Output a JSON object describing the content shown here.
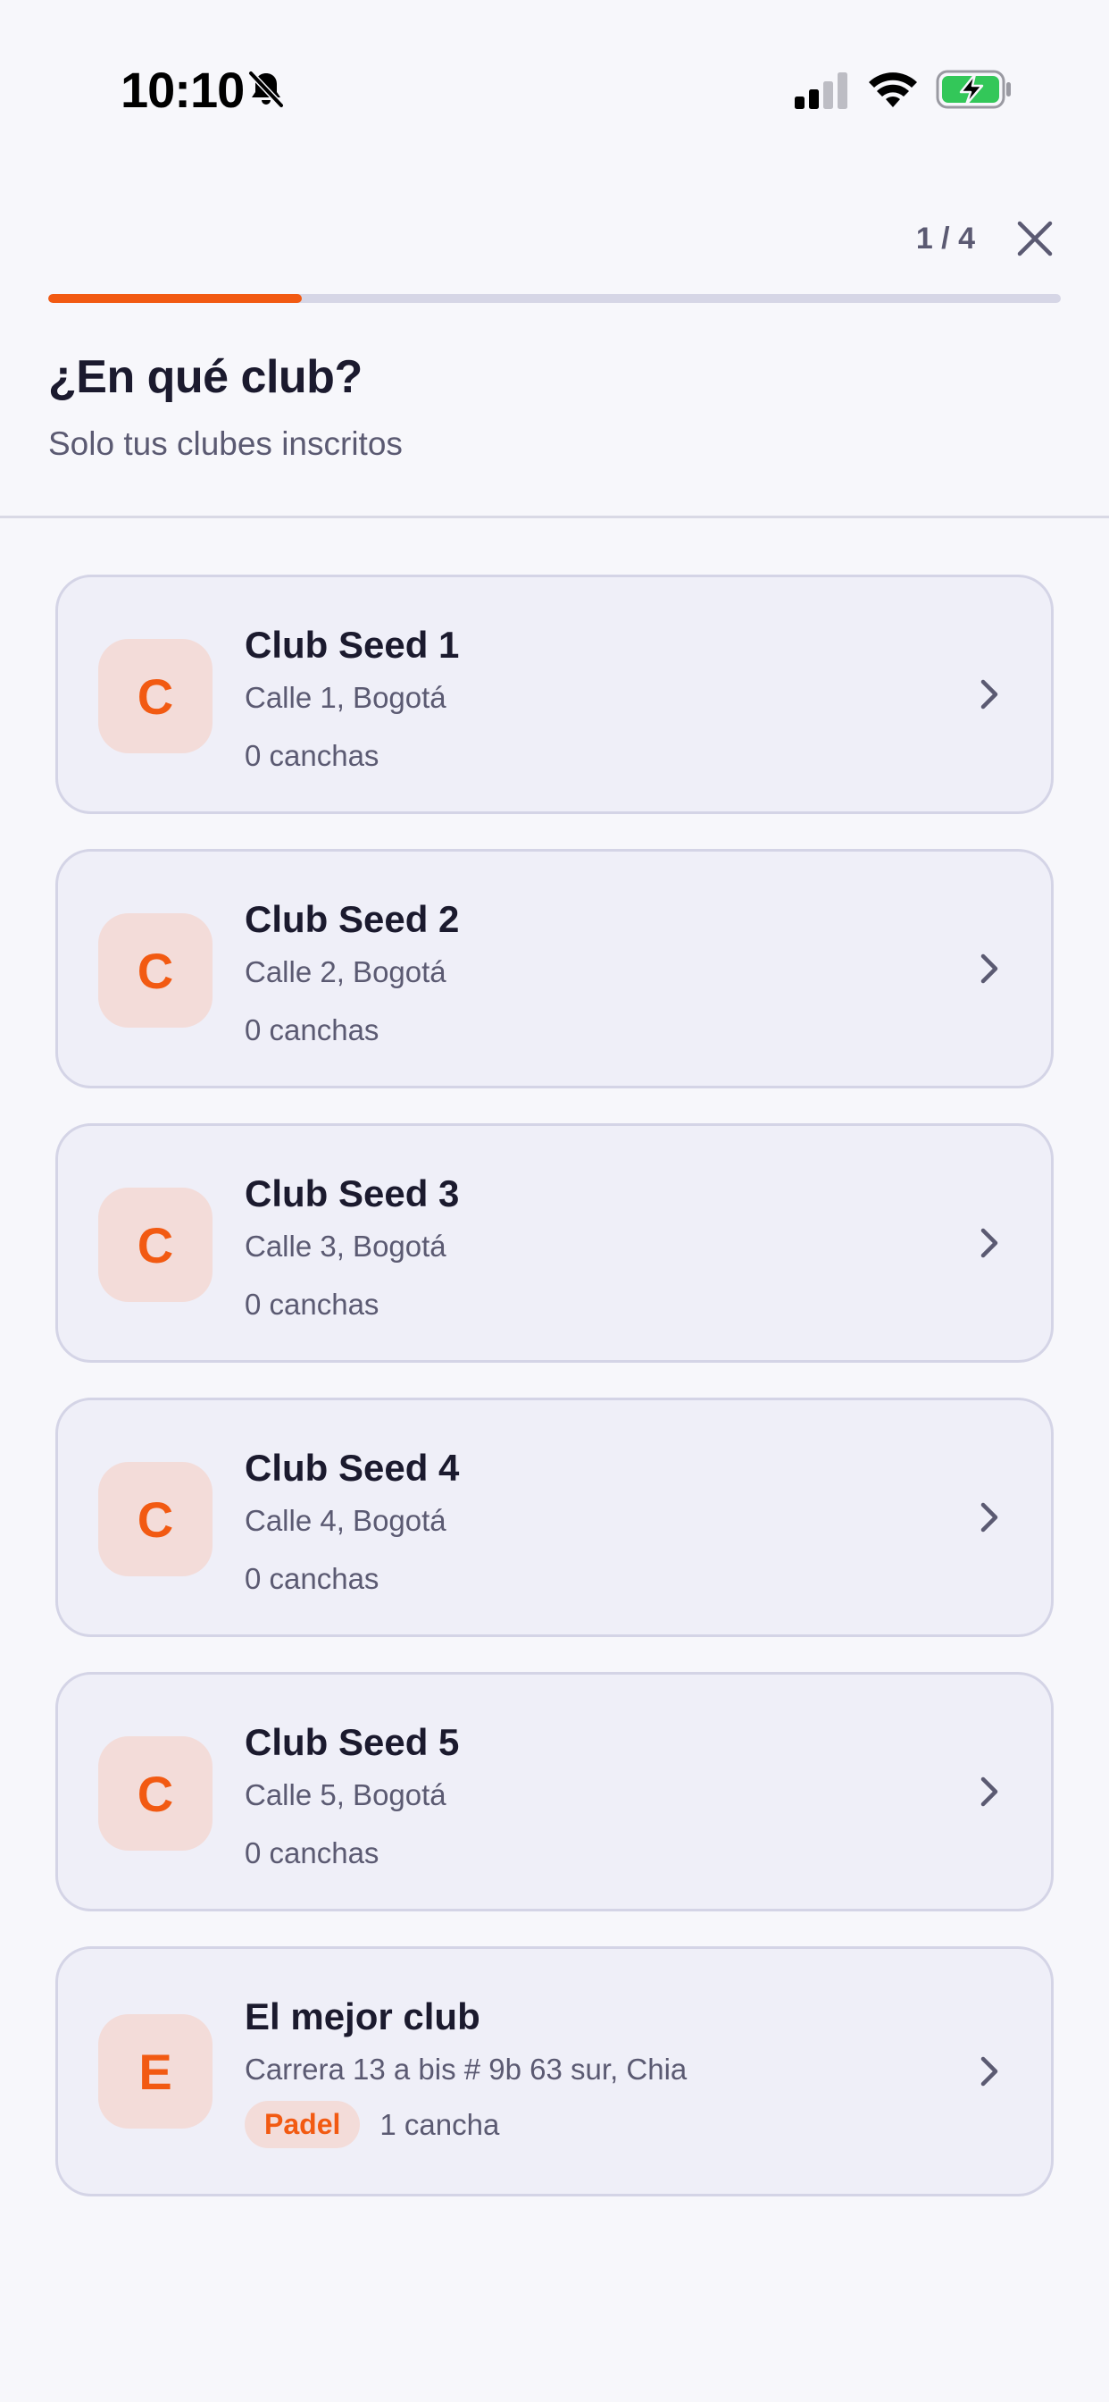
{
  "status_bar": {
    "time": "10:10",
    "icons": [
      "bell-muted-icon",
      "signal-icon",
      "wifi-icon",
      "battery-charging-icon"
    ]
  },
  "header": {
    "step_counter": "1 / 4",
    "close_icon": "close-icon",
    "progress": 0.25,
    "title": "¿En qué club?",
    "subtitle": "Solo tus clubes inscritos"
  },
  "colors": {
    "accent": "#f25a12",
    "avatar_bg": "#f3dcd9",
    "card_bg": "#efeff8",
    "card_border": "#d4d4e6",
    "muted_text": "#5b5a72"
  },
  "clubs": [
    {
      "initial": "C",
      "name": "Club Seed 1",
      "address": "Calle 1, Bogotá",
      "courts": "0 canchas"
    },
    {
      "initial": "C",
      "name": "Club Seed 2",
      "address": "Calle 2, Bogotá",
      "courts": "0 canchas"
    },
    {
      "initial": "C",
      "name": "Club Seed 3",
      "address": "Calle 3, Bogotá",
      "courts": "0 canchas"
    },
    {
      "initial": "C",
      "name": "Club Seed 4",
      "address": "Calle 4, Bogotá",
      "courts": "0 canchas"
    },
    {
      "initial": "C",
      "name": "Club Seed 5",
      "address": "Calle 5, Bogotá",
      "courts": "0 canchas"
    },
    {
      "initial": "E",
      "name": "El mejor club",
      "address": "Carrera 13 a bis # 9b 63 sur, Chia",
      "sport": "Padel",
      "courts": "1 cancha"
    }
  ]
}
